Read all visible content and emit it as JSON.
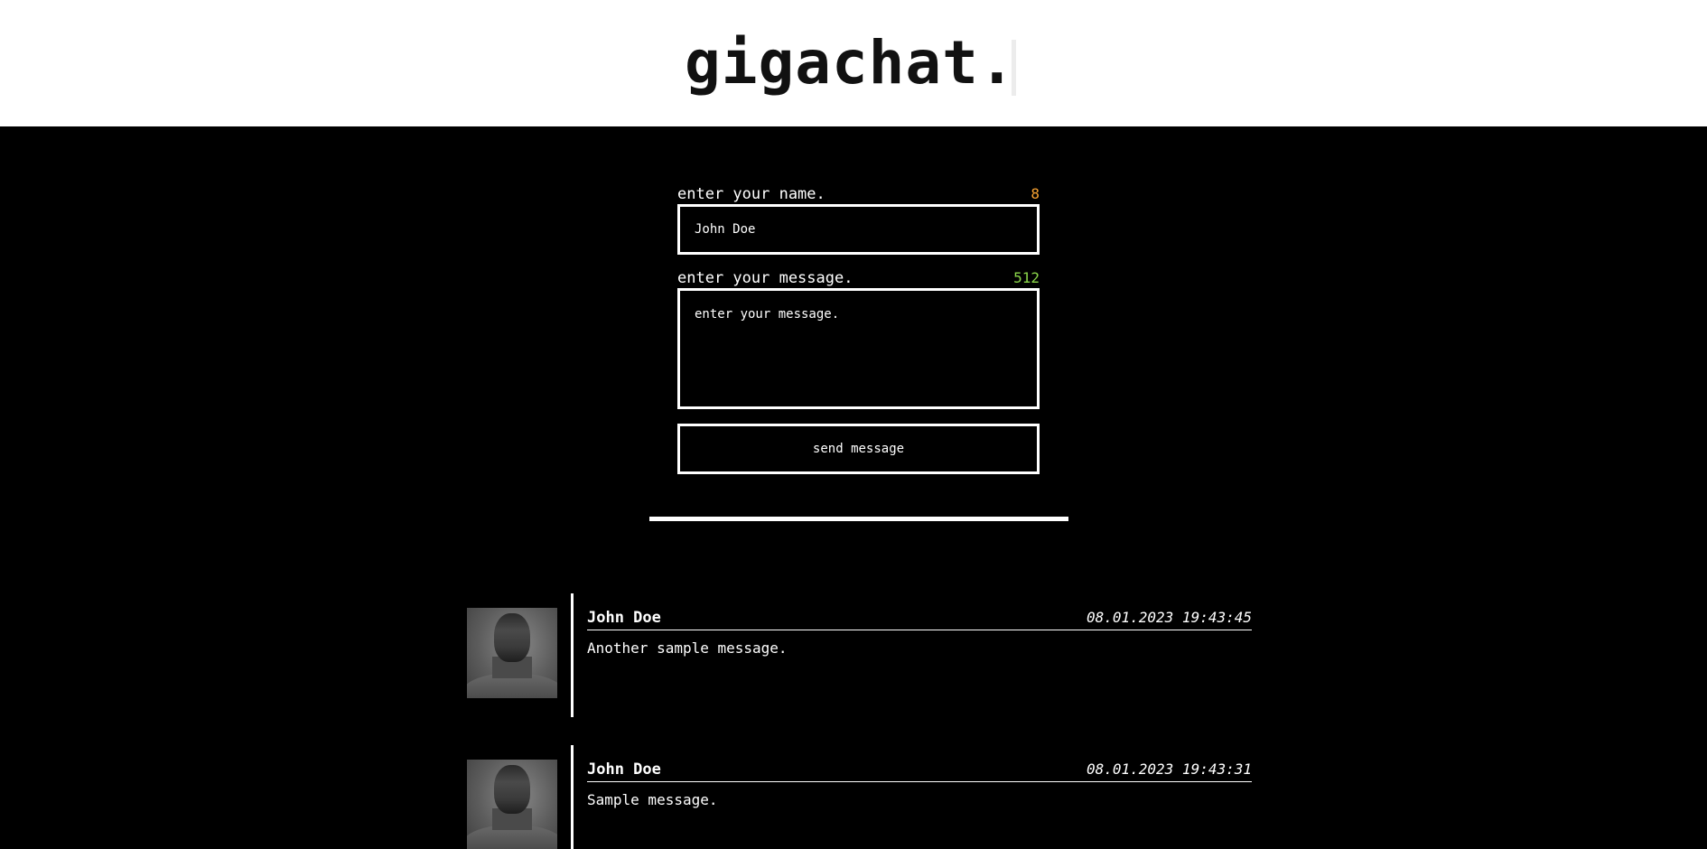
{
  "header": {
    "logo": "gigachat."
  },
  "form": {
    "name_label": "enter your name.",
    "name_counter": "8",
    "name_value": "John Doe",
    "message_label": "enter your message.",
    "message_counter": "512",
    "message_placeholder": "enter your message.",
    "send_label": "send message"
  },
  "colors": {
    "name_counter": "#f7a231",
    "message_counter": "#8bd64a",
    "background": "#000000",
    "header_background": "#ffffff"
  },
  "messages": [
    {
      "author": "John Doe",
      "timestamp": "08.01.2023 19:43:45",
      "text": "Another sample message.",
      "avatar_icon": "avatar-photo"
    },
    {
      "author": "John Doe",
      "timestamp": "08.01.2023 19:43:31",
      "text": "Sample message.",
      "avatar_icon": "avatar-photo"
    }
  ]
}
